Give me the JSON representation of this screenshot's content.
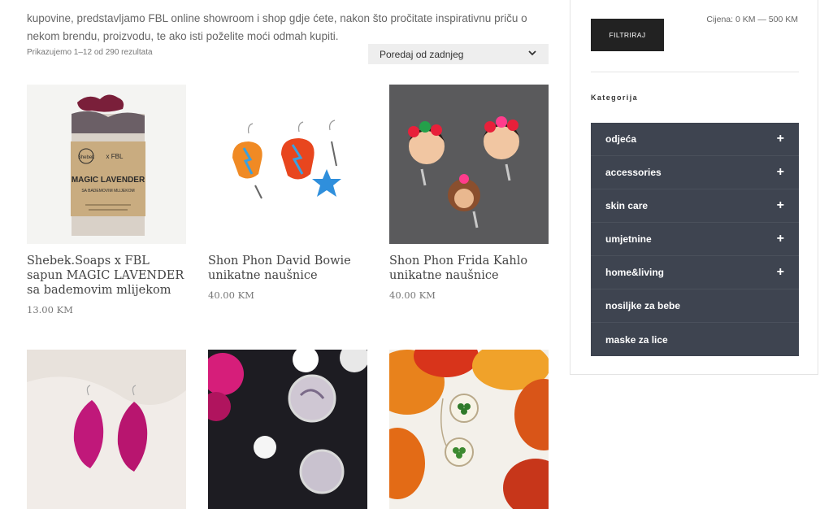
{
  "intro": {
    "text": "kupovine, predstavljamo FBL online showroom i shop gdje ćete, nakon što pročitate inspirativnu priču o nekom brendu, proizvodu, te ako isti poželite moći odmah kupiti."
  },
  "shop": {
    "result_count": "Prikazujemo 1–12 od 290 rezultata",
    "sort": {
      "selected": "Poredaj od zadnjeg"
    }
  },
  "products": [
    {
      "title": "Shebek.Soaps x FBL sapun MAGIC LAVENDER sa bademovim mlijekom",
      "price": "13.00 KM",
      "label_brand": "Shebek",
      "label_x": "x FBL",
      "label_name": "MAGIC LAVENDER",
      "label_sub": "SA BADEMOVIM MLIJEKOM"
    },
    {
      "title": "Shon Phon David Bowie unikatne naušnice",
      "price": "40.00 KM"
    },
    {
      "title": "Shon Phon Frida Kahlo unikatne naušnice",
      "price": "40.00 KM"
    },
    {
      "title": "",
      "price": ""
    },
    {
      "title": "",
      "price": ""
    },
    {
      "title": "",
      "price": ""
    }
  ],
  "sidebar": {
    "filter_label": "FILTRIRAJ",
    "price_range": "Cijena: 0 KM — 500 KM",
    "categories_title": "Kategorija",
    "categories": [
      {
        "label": "odjeća",
        "expand": "+"
      },
      {
        "label": "accessories",
        "expand": "+"
      },
      {
        "label": "skin care",
        "expand": "+"
      },
      {
        "label": "umjetnine",
        "expand": "+"
      },
      {
        "label": "home&living",
        "expand": "+"
      },
      {
        "label": "nosiljke za bebe",
        "expand": ""
      },
      {
        "label": "maske za lice",
        "expand": ""
      }
    ]
  },
  "colors": {
    "category_bg": "#3e4450",
    "button_bg": "#222222",
    "sort_bg": "#eeeeee"
  },
  "icons": {
    "sort": "chevron-down-icon",
    "expand": "plus-icon"
  }
}
